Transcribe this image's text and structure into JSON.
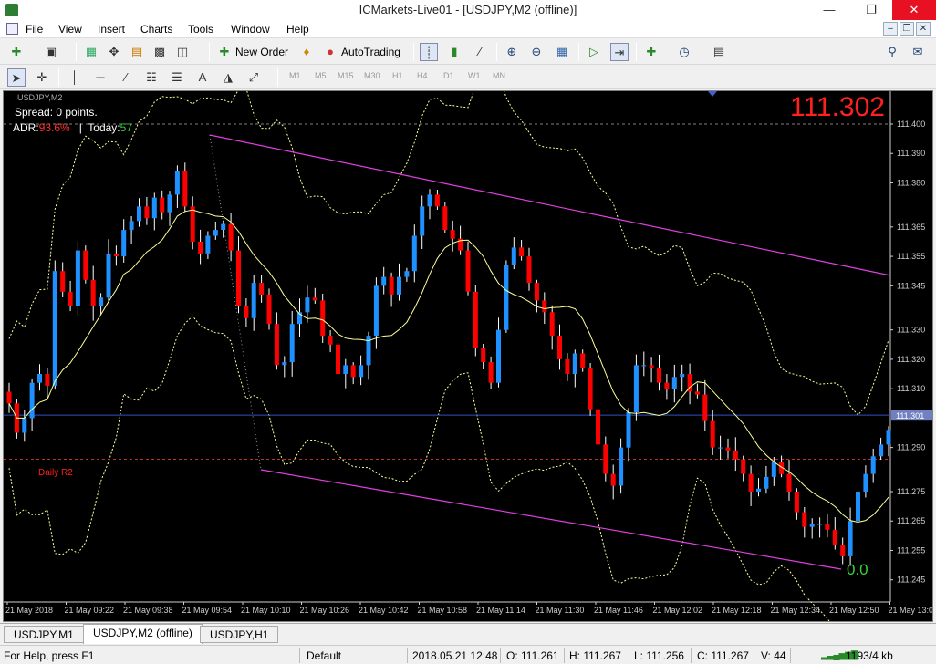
{
  "window": {
    "title": "ICMarkets-Live01 - [USDJPY,M2 (offline)]"
  },
  "menu": [
    "File",
    "View",
    "Insert",
    "Charts",
    "Tools",
    "Window",
    "Help"
  ],
  "toolbar": {
    "new_order": "New Order",
    "autotrading": "AutoTrading",
    "timeframes": [
      "M1",
      "M5",
      "M15",
      "M30",
      "H1",
      "H4",
      "D1",
      "W1",
      "MN"
    ]
  },
  "chart": {
    "symbol_label": "USDJPY,M2",
    "spread_text": "Spread: 0 points.",
    "adr_label": "ADR:",
    "adr_value": "93.6%",
    "today_label": "|  Today:",
    "today_value": "57",
    "big_price": "111.302",
    "daily_r2": "Daily R2",
    "fib_zero": "0.0",
    "colors": {
      "bull": "#1e90ff",
      "bear": "#ff0000",
      "ma": "#ffff99",
      "bands": "#ffff99",
      "channel": "#e040e0",
      "price_line": "#3050c0",
      "r2_line": "#c03030",
      "grid": "#808080"
    }
  },
  "chart_data": {
    "type": "candlestick",
    "symbol": "USDJPY",
    "timeframe": "M2",
    "y_ticks": [
      "111.400",
      "111.390",
      "111.380",
      "111.365",
      "111.355",
      "111.345",
      "111.330",
      "111.320",
      "111.310",
      "111.301",
      "111.290",
      "111.275",
      "111.265",
      "111.255",
      "111.245"
    ],
    "current_price": "111.301",
    "x_ticks": [
      "21 May 2018",
      "21 May 09:22",
      "21 May 09:38",
      "21 May 09:54",
      "21 May 10:10",
      "21 May 10:26",
      "21 May 10:42",
      "21 May 10:58",
      "21 May 11:14",
      "21 May 11:30",
      "21 May 11:46",
      "21 May 12:02",
      "21 May 12:18",
      "21 May 12:34",
      "21 May 12:50",
      "21 May 13:0"
    ],
    "ylim": [
      111.245,
      111.4
    ],
    "closes": [
      111.305,
      111.295,
      111.3,
      111.312,
      111.315,
      111.311,
      111.35,
      111.343,
      111.338,
      111.357,
      111.347,
      111.338,
      111.341,
      111.356,
      111.355,
      111.364,
      111.367,
      111.372,
      111.368,
      111.375,
      111.37,
      111.376,
      111.384,
      111.372,
      111.36,
      111.356,
      111.362,
      111.364,
      111.366,
      111.357,
      111.338,
      111.334,
      111.346,
      111.342,
      111.332,
      111.318,
      111.319,
      111.332,
      111.336,
      111.341,
      111.34,
      111.328,
      111.325,
      111.315,
      111.318,
      111.314,
      111.318,
      111.328,
      111.345,
      111.348,
      111.342,
      111.348,
      111.35,
      111.362,
      111.372,
      111.376,
      111.372,
      111.364,
      111.361,
      111.357,
      111.343,
      111.324,
      111.319,
      111.312,
      111.33,
      111.352,
      111.358,
      111.355,
      111.346,
      111.34,
      111.336,
      111.328,
      111.32,
      111.315,
      111.322,
      111.317,
      111.303,
      111.291,
      111.281,
      111.277,
      111.29,
      111.302,
      111.318,
      111.318,
      111.317,
      111.312,
      111.31,
      111.314,
      111.315,
      111.309,
      111.308,
      111.299,
      111.29,
      111.29,
      111.289,
      111.286,
      111.281,
      111.275,
      111.276,
      111.28,
      111.285,
      111.281,
      111.275,
      111.268,
      111.263,
      111.264,
      111.264,
      111.262,
      111.257,
      111.253,
      111.265,
      111.275,
      111.281,
      111.287,
      111.291,
      111.296
    ]
  },
  "tabs": [
    "USDJPY,M1",
    "USDJPY,M2 (offline)",
    "USDJPY,H1"
  ],
  "status": {
    "help": "For Help, press F1",
    "profile": "Default",
    "datetime": "2018.05.21 12:48",
    "open": "O: 111.261",
    "high": "H: 111.267",
    "low": "L: 111.256",
    "close": "C: 111.267",
    "volume": "V: 44",
    "traffic": "1193/4 kb"
  }
}
